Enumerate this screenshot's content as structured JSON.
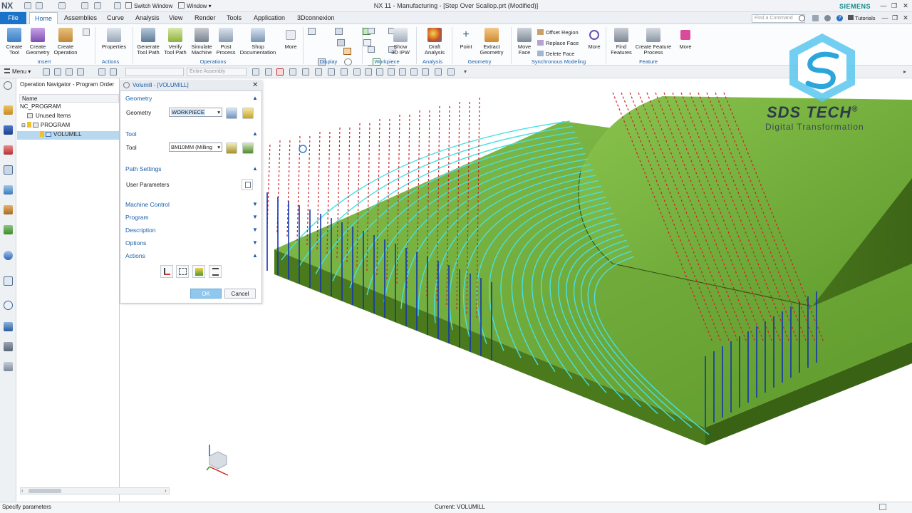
{
  "window": {
    "logo": "NX",
    "switch_window": "Switch Window",
    "window_menu": "Window",
    "title": "NX 11 - Manufacturing - [Step Over Scallop.prt (Modified)]",
    "brand": "SIEMENS"
  },
  "menu": {
    "tabs": [
      "File",
      "Home",
      "Assemblies",
      "Curve",
      "Analysis",
      "View",
      "Render",
      "Tools",
      "Application",
      "3Dconnexion"
    ],
    "active": "Home",
    "find_placeholder": "Find a Command",
    "tutorials": "Tutorials"
  },
  "ribbon": {
    "buttons": {
      "create_tool": "Create\nTool",
      "create_geometry": "Create\nGeometry",
      "create_operation": "Create\nOperation",
      "properties": "Properties",
      "generate_tool_path": "Generate\nTool Path",
      "verify_tool_path": "Verify\nTool Path",
      "simulate_machine": "Simulate\nMachine",
      "post_process": "Post\nProcess",
      "shop_documentation": "Shop\nDocumentation",
      "more1": "More",
      "show_3d_ipw": "Show\n3D IPW",
      "draft_analysis": "Draft\nAnalysis",
      "point": "Point",
      "extract_geometry": "Extract\nGeometry",
      "move_face": "Move\nFace",
      "offset_region": "Offset Region",
      "replace_face": "Replace Face",
      "delete_face": "Delete Face",
      "more2": "More",
      "find_features": "Find\nFeatures",
      "create_feature_process": "Create Feature\nProcess",
      "more3": "More"
    },
    "groups": {
      "insert": "Insert",
      "actions": "Actions",
      "operations": "Operations",
      "display": "Display",
      "workpiece": "Workpiece",
      "analysis": "Analysis",
      "geometry": "Geometry",
      "synchronous_modeling": "Synchronous Modeling",
      "feature": "Feature"
    }
  },
  "toolbar": {
    "menu": "Menu",
    "filter_placeholder": "Entire Assembly"
  },
  "navigator": {
    "title": "Operation Navigator - Program Order",
    "column": "Name",
    "rows": [
      "NC_PROGRAM",
      "Unused Items",
      "PROGRAM",
      "VOLUMILL"
    ]
  },
  "dialog": {
    "title": "Volumill - [VOLUMILL]",
    "sections": {
      "geometry": "Geometry",
      "tool": "Tool",
      "path_settings": "Path Settings",
      "machine_control": "Machine Control",
      "program": "Program",
      "description": "Description",
      "options": "Options",
      "actions": "Actions"
    },
    "geometry_label": "Geometry",
    "geometry_value": "WORKPIECE",
    "tool_label": "Tool",
    "tool_value": "BM10MM (Milling",
    "user_parameters": "User Parameters",
    "ok": "OK",
    "cancel": "Cancel"
  },
  "logo_overlay": {
    "name": "SDS TECH",
    "registered": "®",
    "tagline": "Digital Transformation"
  },
  "status": {
    "left": "Specify parameters",
    "center": "Current: VOLUMILL"
  },
  "colors": {
    "accent": "#1a73c9",
    "part_green": "#6fa83a",
    "toolpath_cyan": "#48e0e0",
    "rapid_red": "#d0202a",
    "plunge_blue": "#1236b0"
  }
}
